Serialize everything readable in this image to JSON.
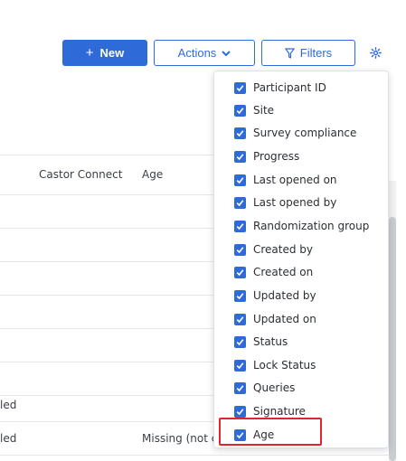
{
  "toolbar": {
    "new_label": "New",
    "actions_label": "Actions",
    "filters_label": "Filters"
  },
  "table": {
    "headers": {
      "castor_connect": "Castor Connect",
      "age": "Age"
    },
    "rows": [
      {
        "left": "",
        "age": ""
      },
      {
        "left": "",
        "age": ""
      },
      {
        "left": "",
        "age": ""
      },
      {
        "left": "",
        "age": ""
      },
      {
        "left": "",
        "age": ""
      },
      {
        "left": "",
        "age": ""
      },
      {
        "left": "led",
        "age": ""
      },
      {
        "left": "led",
        "age": "Missing (not c"
      }
    ]
  },
  "column_menu": {
    "items": [
      {
        "label": "Participant ID",
        "checked": true
      },
      {
        "label": "Site",
        "checked": true
      },
      {
        "label": "Survey compliance",
        "checked": true
      },
      {
        "label": "Progress",
        "checked": true
      },
      {
        "label": "Last opened on",
        "checked": true
      },
      {
        "label": "Last opened by",
        "checked": true
      },
      {
        "label": "Randomization group",
        "checked": true
      },
      {
        "label": "Created by",
        "checked": true
      },
      {
        "label": "Created on",
        "checked": true
      },
      {
        "label": "Updated by",
        "checked": true
      },
      {
        "label": "Updated on",
        "checked": true
      },
      {
        "label": "Status",
        "checked": true
      },
      {
        "label": "Lock Status",
        "checked": true
      },
      {
        "label": "Queries",
        "checked": true
      },
      {
        "label": "Signature",
        "checked": true
      },
      {
        "label": "Age",
        "checked": true
      }
    ]
  },
  "colors": {
    "accent": "#2f6bd8",
    "highlight": "#e0252b"
  }
}
